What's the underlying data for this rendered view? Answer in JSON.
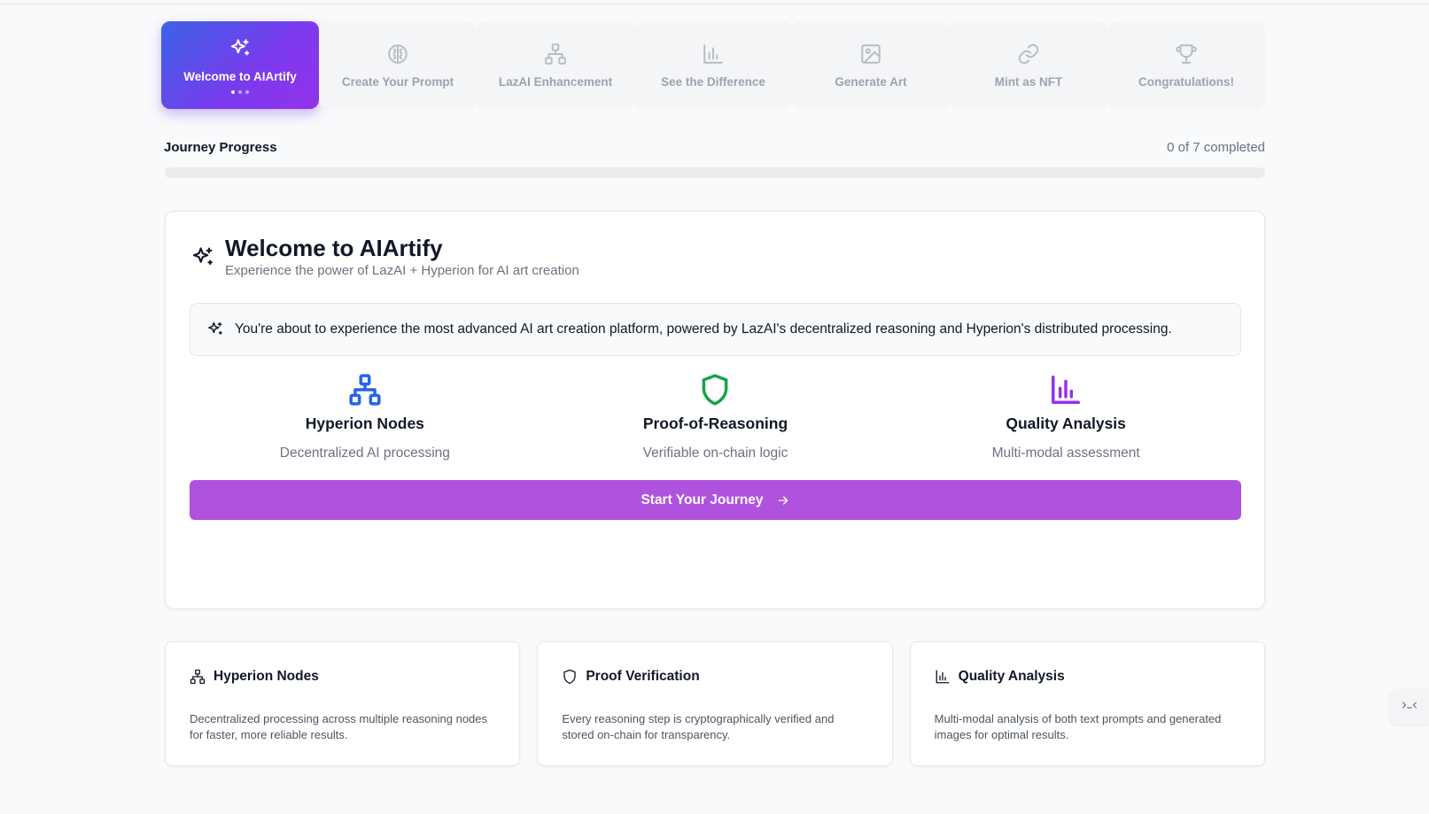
{
  "steps": [
    {
      "label": "Welcome to AIArtify",
      "icon": "sparkles-icon",
      "active": true
    },
    {
      "label": "Create Your Prompt",
      "icon": "brain-icon",
      "active": false
    },
    {
      "label": "LazAI Enhancement",
      "icon": "network-icon",
      "active": false
    },
    {
      "label": "See the Difference",
      "icon": "bar-chart-icon",
      "active": false
    },
    {
      "label": "Generate Art",
      "icon": "image-icon",
      "active": false
    },
    {
      "label": "Mint as NFT",
      "icon": "link-icon",
      "active": false
    },
    {
      "label": "Congratulations!",
      "icon": "trophy-icon",
      "active": false
    }
  ],
  "progress": {
    "title": "Journey Progress",
    "count_text": "0 of 7 completed",
    "completed": 0,
    "total": 7,
    "fill_color": "#7c3aed"
  },
  "main": {
    "title": "Welcome to AIArtify",
    "subtitle": "Experience the power of LazAI + Hyperion for AI art creation",
    "notice": "You're about to experience the most advanced AI art creation platform, powered by LazAI's decentralized reasoning and Hyperion's distributed processing.",
    "features": [
      {
        "title": "Hyperion Nodes",
        "desc": "Decentralized AI processing",
        "icon": "network-icon",
        "color": "#2563eb"
      },
      {
        "title": "Proof-of-Reasoning",
        "desc": "Verifiable on-chain logic",
        "icon": "shield-icon",
        "color": "#16a34a"
      },
      {
        "title": "Quality Analysis",
        "desc": "Multi-modal assessment",
        "icon": "bar-chart-icon",
        "color": "#9333ea"
      }
    ],
    "start_button": "Start Your Journey",
    "button_color": "#af52de"
  },
  "info_cards": [
    {
      "title": "Hyperion Nodes",
      "icon": "network-icon",
      "desc": "Decentralized processing across multiple reasoning nodes for faster, more reliable results."
    },
    {
      "title": "Proof Verification",
      "icon": "shield-icon",
      "desc": "Every reasoning step is cryptographically verified and stored on-chain for transparency."
    },
    {
      "title": "Quality Analysis",
      "icon": "bar-chart-icon",
      "desc": "Multi-modal analysis of both text prompts and generated images for optimal results."
    }
  ],
  "side_widget": {
    "icon": "code-icon"
  }
}
